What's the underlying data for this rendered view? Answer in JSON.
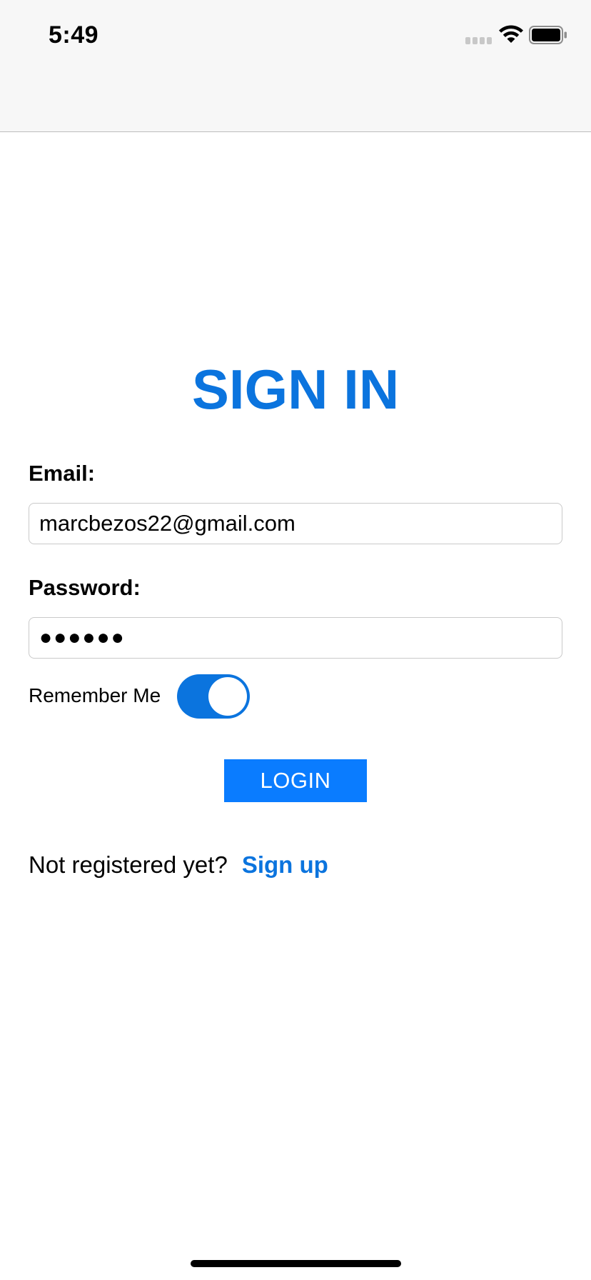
{
  "status_bar": {
    "time": "5:49",
    "icons": [
      "cellular-signal-icon",
      "wifi-icon",
      "battery-icon"
    ]
  },
  "form": {
    "title": "SIGN IN",
    "email_label": "Email:",
    "email_value": "marcbezos22@gmail.com",
    "password_label": "Password:",
    "password_value": "●●●●●●",
    "remember_label": "Remember Me",
    "remember_on": true,
    "login_label": "LOGIN"
  },
  "footer": {
    "prompt": "Not registered yet?",
    "signup_label": "Sign up"
  },
  "colors": {
    "accent": "#0b74de",
    "button": "#0a7cff",
    "status_bar_bg": "#f7f7f7"
  }
}
